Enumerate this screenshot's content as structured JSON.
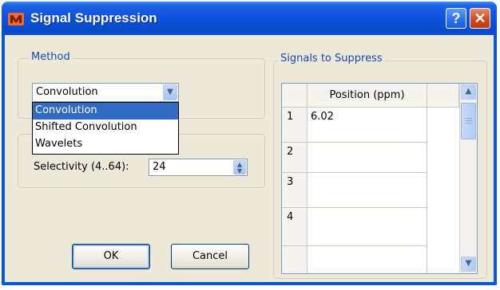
{
  "window": {
    "title": "Signal Suppression"
  },
  "titlebar": {
    "help_glyph": "?",
    "close_glyph": "✕"
  },
  "method": {
    "group_title": "Method",
    "selected": "Convolution",
    "options": [
      "Convolution",
      "Shifted Convolution",
      "Wavelets"
    ],
    "selected_index": 0
  },
  "selectivity": {
    "label": "Selectivity (4..64):",
    "value": "24"
  },
  "signals": {
    "group_title": "Signals to Suppress",
    "column_header": "Position (ppm)",
    "rows": [
      {
        "num": "1",
        "position": "6.02"
      },
      {
        "num": "2",
        "position": ""
      },
      {
        "num": "3",
        "position": ""
      },
      {
        "num": "4",
        "position": ""
      }
    ]
  },
  "buttons": {
    "ok": "OK",
    "cancel": "Cancel"
  },
  "icons": {
    "app": "app-logo-icon",
    "help": "question-icon",
    "close": "close-icon",
    "dropdown": "chevron-down-icon",
    "spin": "spin-arrows-icon",
    "scroll_up": "arrow-up-icon",
    "scroll_down": "arrow-down-icon"
  },
  "colors": {
    "title_bar": "#0b55e0",
    "selection": "#316ac5",
    "group_title": "#1a46b8",
    "close_button": "#d5481e"
  }
}
